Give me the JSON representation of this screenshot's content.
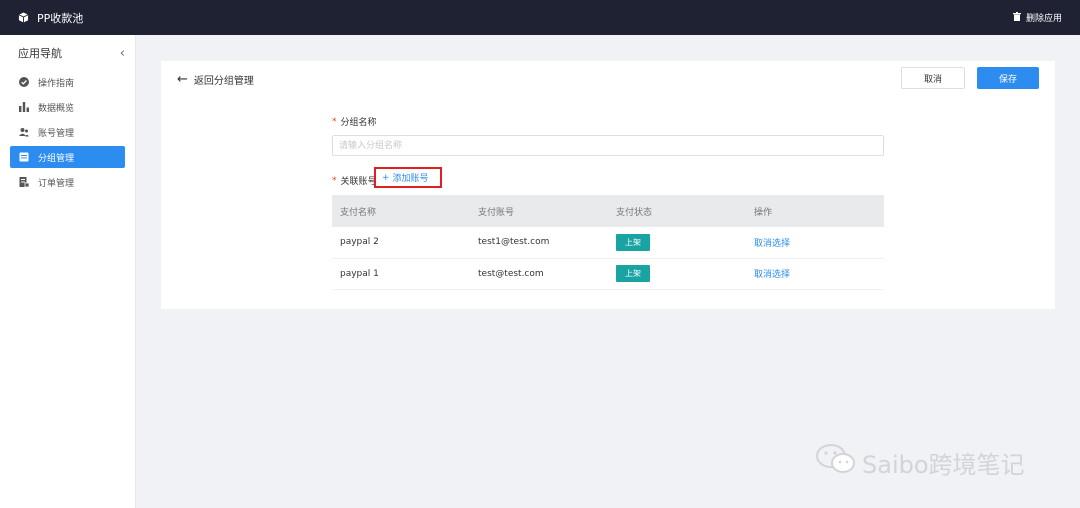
{
  "topbar": {
    "app_title": "PP收款池",
    "delete_app_label": "删除应用"
  },
  "sidebar": {
    "title": "应用导航",
    "collapse_glyph": "‹",
    "items": [
      {
        "label": "操作指南",
        "icon": "check-circle-icon",
        "active": false
      },
      {
        "label": "数据概览",
        "icon": "bar-chart-icon",
        "active": false
      },
      {
        "label": "账号管理",
        "icon": "users-icon",
        "active": false
      },
      {
        "label": "分组管理",
        "icon": "group-icon",
        "active": true
      },
      {
        "label": "订单管理",
        "icon": "order-icon",
        "active": false
      }
    ]
  },
  "main": {
    "back_label": "返回分组管理",
    "cancel_label": "取消",
    "save_label": "保存",
    "group_name_label": "分组名称",
    "group_name_placeholder": "请输入分组名称",
    "group_name_value": "",
    "linked_accounts_label": "关联账号",
    "add_account_label": "添加账号",
    "table": {
      "headers": [
        "支付名称",
        "支付账号",
        "支付状态",
        "操作"
      ],
      "rows": [
        {
          "name": "paypal 2",
          "account": "test1@test.com",
          "status": "上架",
          "action": "取消选择"
        },
        {
          "name": "paypal 1",
          "account": "test@test.com",
          "status": "上架",
          "action": "取消选择"
        }
      ]
    }
  },
  "watermark": {
    "text": "Saibo跨境笔记"
  },
  "colors": {
    "primary": "#2d8cf0",
    "topbar": "#1e2233",
    "status": "#19a3a3",
    "highlight": "#e02020"
  }
}
